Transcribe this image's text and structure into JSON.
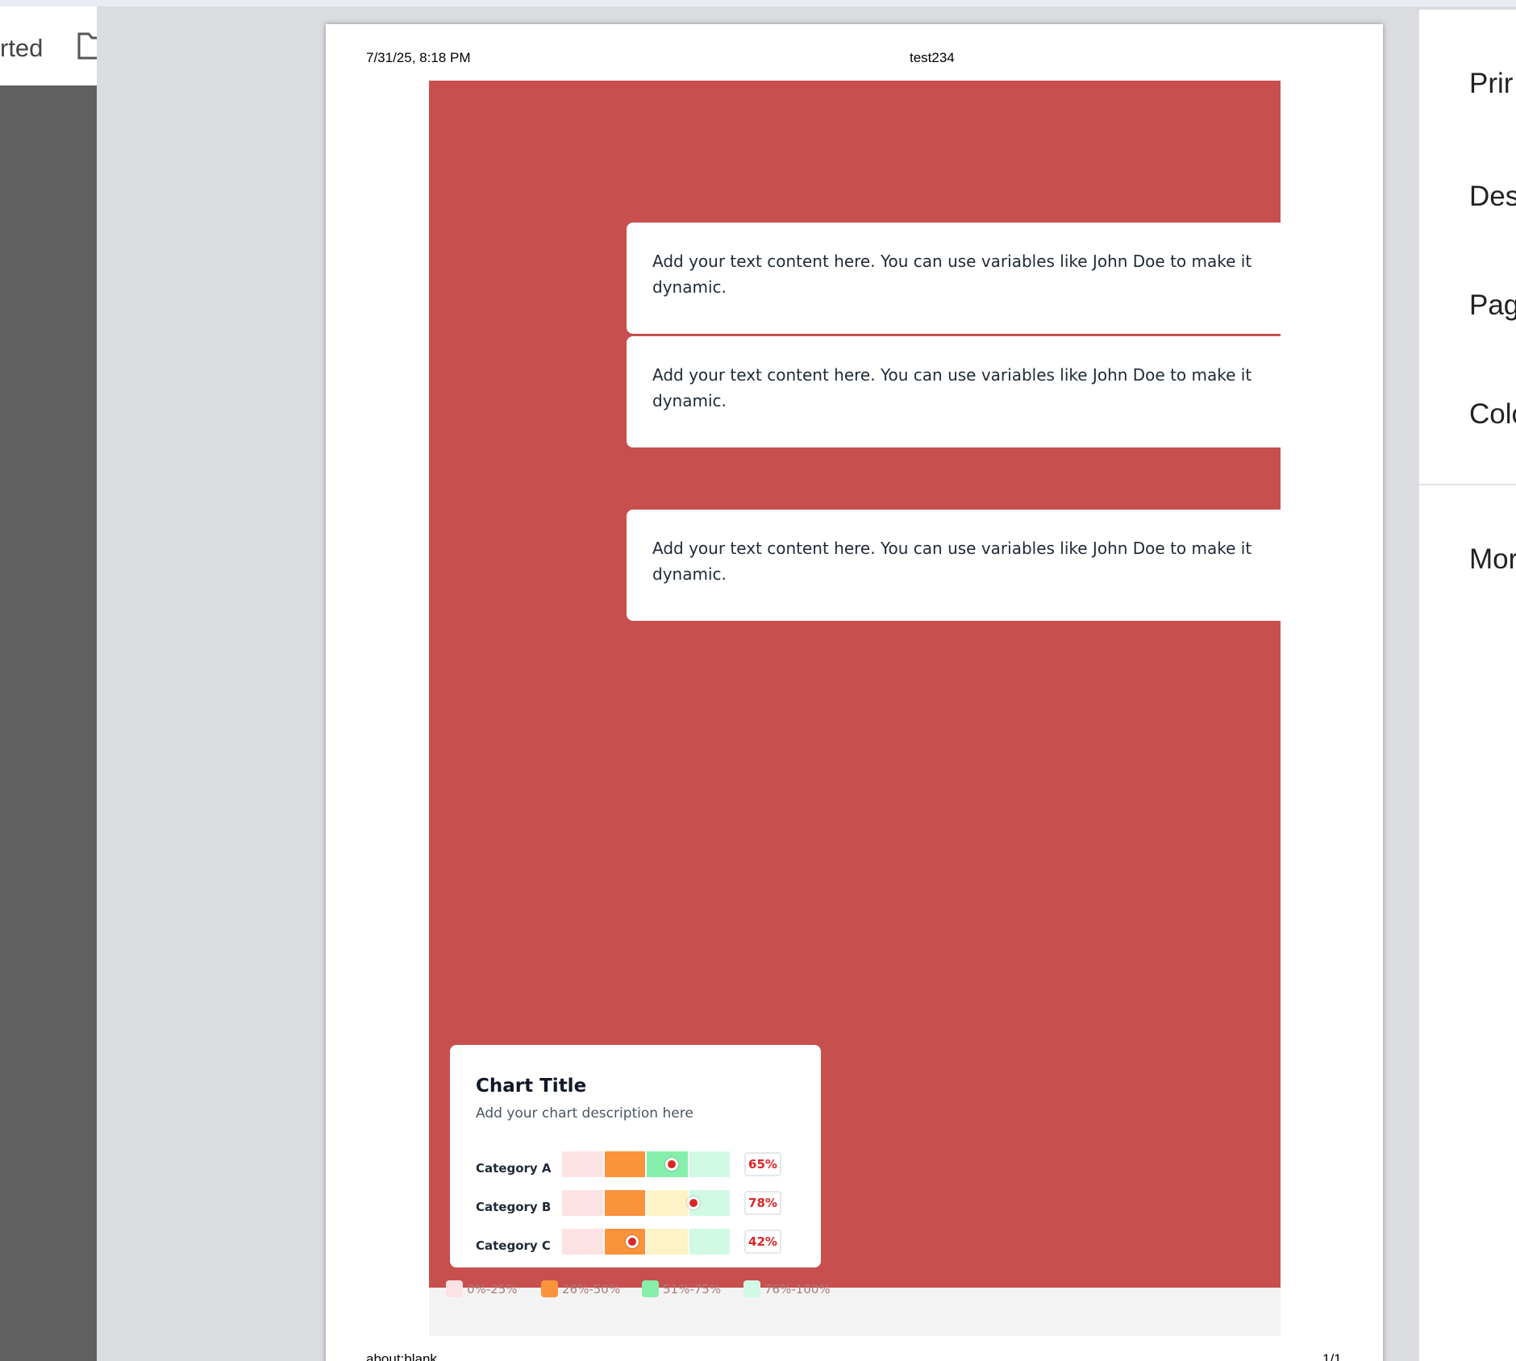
{
  "browser": {
    "tab_title_fragment": "rted"
  },
  "print_preview": {
    "header": {
      "date": "7/31/25, 8:18 PM",
      "title": "test234"
    },
    "footer": {
      "url": "about:blank",
      "page": "1/1"
    },
    "canvas_color": "#c74f4d",
    "text_blocks": [
      "Add your text content here. You can use variables like John Doe to make it dynamic.",
      "Add your text content here. You can use variables like John Doe to make it dynamic.",
      "Add your text content here. You can use variables like John Doe to make it dynamic."
    ]
  },
  "chart": {
    "title": "Chart Title",
    "description": "Add your chart description here"
  },
  "chart_data": {
    "type": "bar",
    "title": "Chart Title",
    "subtitle": "Add your chart description here",
    "categories": [
      "Category A",
      "Category B",
      "Category C"
    ],
    "values": [
      65,
      78,
      42
    ],
    "value_labels": [
      "65%",
      "78%",
      "42%"
    ],
    "unit": "%",
    "ylim": [
      0,
      100
    ],
    "bands": [
      {
        "label": "0%-25%",
        "range": [
          0,
          25
        ],
        "color": "#fde2e4"
      },
      {
        "label": "26%-50%",
        "range": [
          26,
          50
        ],
        "color": "#fb923c"
      },
      {
        "label": "51%-75%",
        "range": [
          51,
          75
        ],
        "color": "#86efac"
      },
      {
        "label": "76%-100%",
        "range": [
          76,
          100
        ],
        "color": "#d1fae5"
      }
    ],
    "legend_position": "bottom"
  },
  "settings_panel": {
    "labels": [
      "Prir",
      "Dest",
      "Page",
      "Colc",
      "Mor"
    ]
  }
}
